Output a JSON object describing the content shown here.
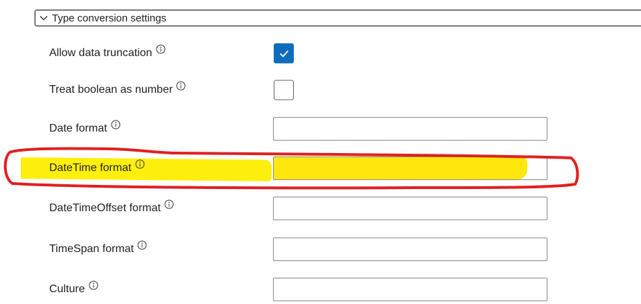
{
  "section": {
    "title": "Type conversion settings",
    "expanded": true,
    "chevron_icon": "chevron-down-icon"
  },
  "fields": [
    {
      "label": "Allow data truncation",
      "control": "checkbox",
      "checked": true
    },
    {
      "label": "Treat boolean as number",
      "control": "checkbox",
      "checked": false
    },
    {
      "label": "Date format",
      "control": "text",
      "value": ""
    },
    {
      "label": "DateTime format",
      "control": "text",
      "value": ""
    },
    {
      "label": "DateTimeOffset format",
      "control": "text",
      "value": ""
    },
    {
      "label": "TimeSpan format",
      "control": "text",
      "value": ""
    },
    {
      "label": "Culture",
      "control": "text",
      "value": ""
    }
  ],
  "info_icon": "info-icon",
  "annotation": {
    "highlight_color": "#ffee00",
    "circle_color": "#e02020",
    "marked_field": "DateTime format"
  },
  "colors": {
    "accent": "#0f6cbd",
    "checkmark": "#ffffff",
    "input_border": "#8a8886",
    "checkbox_border": "#616161"
  }
}
